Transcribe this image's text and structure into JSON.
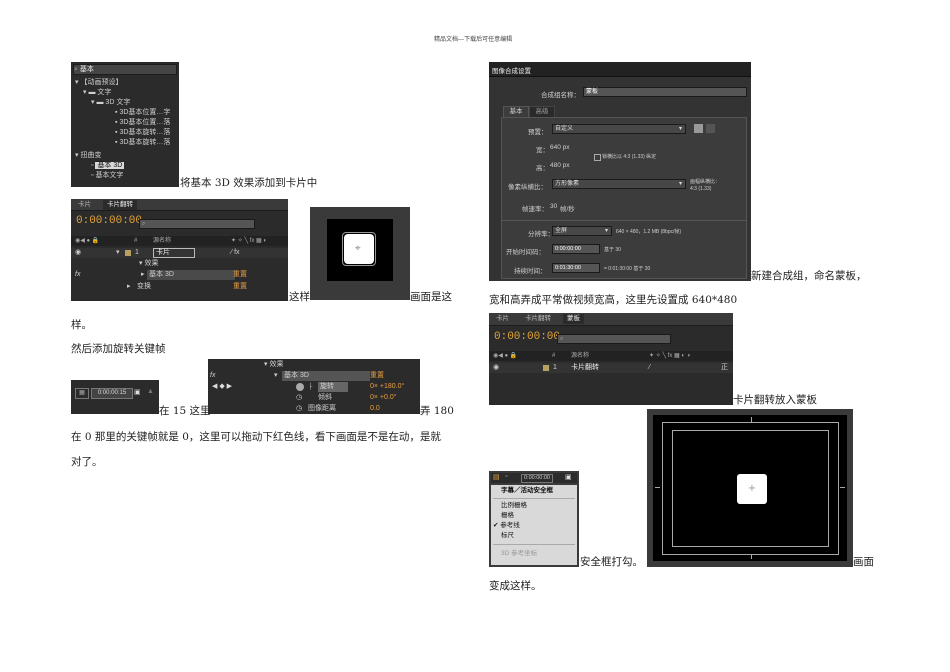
{
  "page_header": "精品文档---下载后可任意编辑",
  "left": {
    "effects_panel": {
      "search_value": "基本",
      "items": [
        "【动画预设】",
        "文字",
        "3D 文字",
        "3D基本位置…字",
        "3D基本位置…落",
        "3D基本旋转…落",
        "3D基本旋转…落",
        "扭曲变",
        "基本 3D",
        "基本文字"
      ]
    },
    "caption1": "将基本 3D 效果添加到卡片中",
    "timeline1": {
      "tabs": [
        "卡片",
        "卡片翻转"
      ],
      "timecode": "0:00:00:00",
      "col_num": "#",
      "col_source": "源名称",
      "layer_num": "1",
      "layer_name": "卡片",
      "effects_label": "效果",
      "fx_label": "fx",
      "effect_name": "基本 3D",
      "reset": "重置",
      "transform_label": "变换",
      "reset2": "重置"
    },
    "caption2a": "这样",
    "caption2b": "画面是这",
    "caption2c": "样。",
    "caption3": "然后添加旋转关键帧",
    "small_timecode": "0:00:00:15",
    "prop_panel": {
      "effects_label": "效果",
      "fx_label": "fx",
      "effect_name": "基本 3D",
      "reset": "重置",
      "props": [
        {
          "name": "旋转",
          "value": "0× +180.0°"
        },
        {
          "name": "倾斜",
          "value": "0× +0.0°"
        },
        {
          "name": "图像距离",
          "value": "0.0"
        }
      ]
    },
    "caption4a": "在 15 这里",
    "caption4b": "弄 180",
    "caption5": "在 0 那里的关键帧就是 0，这里可以拖动下红色线，看下画面是不是在动，是就",
    "caption6": "对了。"
  },
  "right": {
    "comp_dialog": {
      "title": "图像合成设置",
      "name_label": "合成组名称：",
      "name_value": "蒙板",
      "tabs": [
        "基本",
        "高级"
      ],
      "preset_label": "预置：",
      "preset_value": "自定义",
      "width_label": "宽：",
      "width_value": "640 px",
      "height_label": "高：",
      "height_value": "480 px",
      "lock_label": "锁横比以 4:3 (1.33) 纵定",
      "par_label": "像素纵横比：",
      "par_value": "方形像素",
      "frame_aspect_label": "画幅纵横比：",
      "frame_aspect_value": "4:3 (1.33)",
      "fps_label": "帧速率：",
      "fps_value": "30",
      "fps_unit": "帧/秒",
      "res_label": "分辨率：",
      "res_value": "全屏",
      "res_info": "640 × 480，1.2 MB (8bpc/帧)",
      "start_label": "开始时间码：",
      "start_value": "0:00:00:00",
      "start_note": "基于 30",
      "dur_label": "持续时间：",
      "dur_value": "0:01:30:00",
      "dur_note": "= 0:01:30:00 基于 30"
    },
    "caption1a": "新建合成组，命名蒙板，",
    "caption1b": "宽和高弄成平常做视频宽高，这里先设置成 640*480",
    "timeline2": {
      "tabs": [
        "卡片",
        "卡片翻转",
        "蒙板"
      ],
      "timecode": "0:00:00:00",
      "col_num": "#",
      "col_source": "源名称",
      "layer_num": "1",
      "layer_name": "卡片翻转",
      "mode": "正"
    },
    "caption2": "卡片翻转放入蒙板",
    "menu": {
      "timecode": "0:00:00:00",
      "items": [
        "字幕／活动安全框",
        "比例栅格",
        "栅格",
        "参考线",
        "标尺",
        "3D 参考坐标"
      ],
      "checked_index": 3
    },
    "caption3a": "安全框打勾。",
    "caption3b": "画面",
    "caption3c": "变成这样。"
  }
}
